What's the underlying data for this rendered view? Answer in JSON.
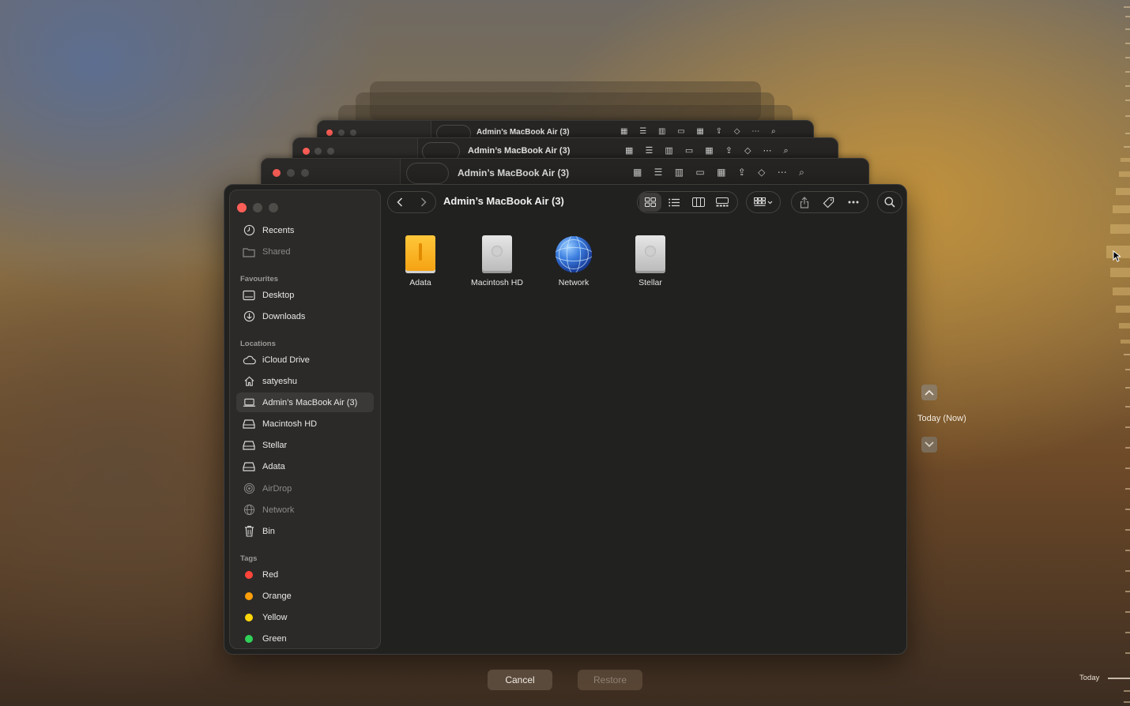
{
  "window": {
    "title": "Admin’s MacBook Air (3)"
  },
  "background_windows": [
    {
      "title": "Admin’s MacBook Air (3)"
    },
    {
      "title": "Admin’s MacBook Air (3)"
    },
    {
      "title": "Admin’s MacBook Air (3)"
    }
  ],
  "sidebar": {
    "top_items": [
      {
        "label": "Recents",
        "icon": "clock-icon"
      },
      {
        "label": "Shared",
        "icon": "shared-folder-icon"
      }
    ],
    "favourites_header": "Favourites",
    "favourites": [
      {
        "label": "Desktop",
        "icon": "desktop-icon"
      },
      {
        "label": "Downloads",
        "icon": "download-icon"
      }
    ],
    "locations_header": "Locations",
    "locations": [
      {
        "label": "iCloud Drive",
        "icon": "cloud-icon"
      },
      {
        "label": "satyeshu",
        "icon": "home-icon"
      },
      {
        "label": "Admin’s MacBook Air (3)",
        "icon": "laptop-icon",
        "selected": true
      },
      {
        "label": "Macintosh HD",
        "icon": "drive-icon"
      },
      {
        "label": "Stellar",
        "icon": "drive-icon"
      },
      {
        "label": "Adata",
        "icon": "drive-icon"
      },
      {
        "label": "AirDrop",
        "icon": "airdrop-icon"
      },
      {
        "label": "Network",
        "icon": "globe-icon"
      },
      {
        "label": "Bin",
        "icon": "trash-icon"
      }
    ],
    "tags_header": "Tags",
    "tags": [
      {
        "label": "Red",
        "color": "#ff453a"
      },
      {
        "label": "Orange",
        "color": "#ff9f0a"
      },
      {
        "label": "Yellow",
        "color": "#ffd60a"
      },
      {
        "label": "Green",
        "color": "#30d158"
      }
    ]
  },
  "files": [
    {
      "label": "Adata",
      "icon": "external-drive-orange-icon"
    },
    {
      "label": "Macintosh HD",
      "icon": "internal-drive-icon"
    },
    {
      "label": "Network",
      "icon": "network-globe-icon"
    },
    {
      "label": "Stellar",
      "icon": "internal-drive-icon"
    }
  ],
  "buttons": {
    "cancel": "Cancel",
    "restore": "Restore"
  },
  "time_machine": {
    "current": "Today (Now)",
    "timeline_label": "Today"
  },
  "colors": {
    "close": "#ff5f57",
    "inactive_light": "#4d4c49",
    "window_bg": "#212120",
    "sidebar_bg": "#2b2a28"
  }
}
